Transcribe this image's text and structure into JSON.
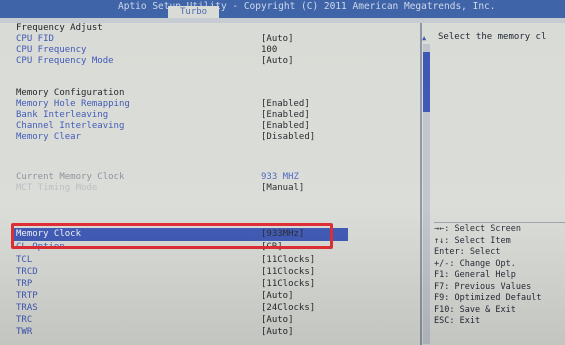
{
  "header": {
    "title": "Aptio Setup Utility - Copyright (C) 2011 American Megatrends, Inc.",
    "tab": "Turbo"
  },
  "sections": {
    "frequency_heading": "Frequency Adjust",
    "memory_heading": "Memory Configuration"
  },
  "settings": {
    "cpu_fid": {
      "label": "CPU FID",
      "value": "[Auto]"
    },
    "cpu_frequency": {
      "label": "CPU Frequency",
      "value": "100"
    },
    "cpu_frequency_mode": {
      "label": "CPU Frequency Mode",
      "value": "[Auto]"
    },
    "memory_hole_remapping": {
      "label": "Memory Hole Remapping",
      "value": "[Enabled]"
    },
    "bank_interleaving": {
      "label": "Bank Interleaving",
      "value": "[Enabled]"
    },
    "channel_interleaving": {
      "label": "Channel Interleaving",
      "value": "[Enabled]"
    },
    "memory_clear": {
      "label": "Memory Clear",
      "value": "[Disabled]"
    },
    "current_memory_clock": {
      "label": "Current Memory Clock",
      "value": "933 MHZ"
    },
    "mct_timing_mode": {
      "label": "MCT Timing Mode",
      "value": "[Manual]"
    },
    "memory_clock": {
      "label": "Memory Clock",
      "value": "[933MHz]"
    },
    "cl_option": {
      "label": "CL Option",
      "value": "[CR]"
    },
    "tcl": {
      "label": "TCL",
      "value": "[11Clocks]"
    },
    "trcd": {
      "label": "TRCD",
      "value": "[11Clocks]"
    },
    "trp": {
      "label": "TRP",
      "value": "[11Clocks]"
    },
    "trtp": {
      "label": "TRTP",
      "value": "[Auto]"
    },
    "tras": {
      "label": "TRAS",
      "value": "[24Clocks]"
    },
    "trc": {
      "label": "TRC",
      "value": "[Auto]"
    },
    "twr": {
      "label": "TWR",
      "value": "[Auto]"
    }
  },
  "help": {
    "text": "Select the memory cl"
  },
  "keys": [
    "→←: Select Screen",
    "↑↓: Select Item",
    "Enter: Select",
    "+/-: Change Opt.",
    "F1: General Help",
    "F7: Previous Values",
    "F9: Optimized Default",
    "F10: Save & Exit",
    "ESC: Exit"
  ],
  "colors": {
    "header_bg": "#3f64a8",
    "panel_bg": "#d9dbd6",
    "selection_bg": "#3a55b4",
    "highlight_border": "#e0262e",
    "label_blue": "#3e57b6"
  }
}
